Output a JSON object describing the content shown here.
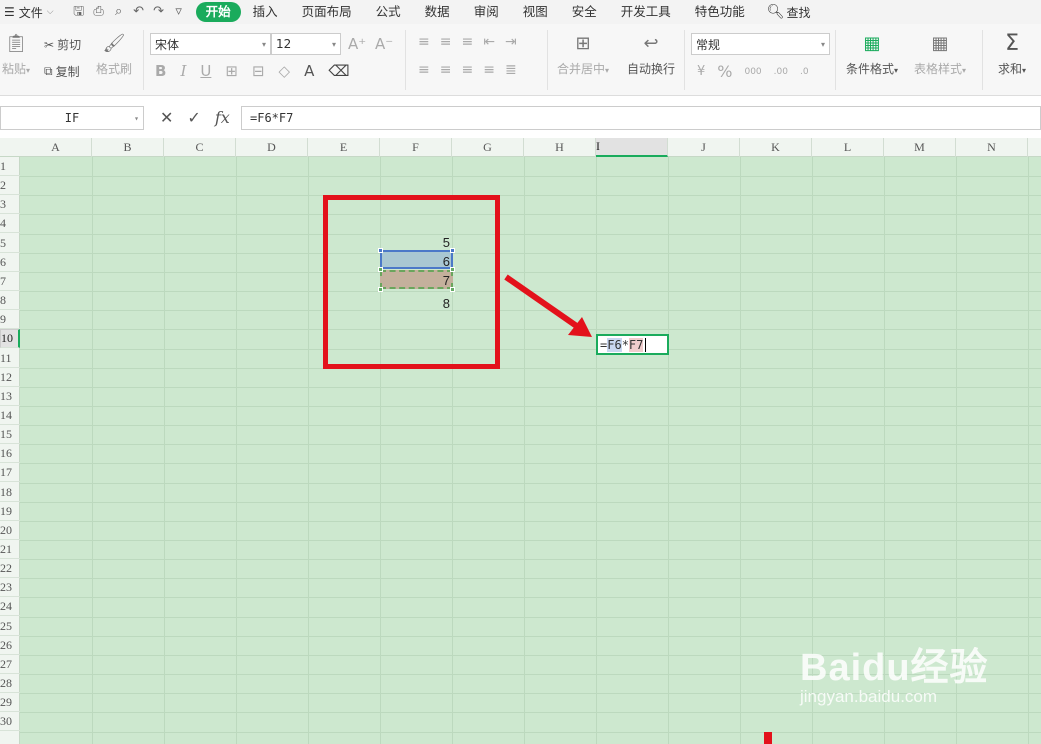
{
  "menu": {
    "file_label": "文件",
    "tabs": [
      "开始",
      "插入",
      "页面布局",
      "公式",
      "数据",
      "审阅",
      "视图",
      "安全",
      "开发工具",
      "特色功能"
    ],
    "active_tab": "开始",
    "search_label": "查找"
  },
  "ribbon": {
    "paste": "粘贴",
    "cut": "剪切",
    "copy": "复制",
    "format_painter": "格式刷",
    "font_name": "宋体",
    "font_size": "12",
    "merge_center": "合并居中",
    "wrap_text": "自动换行",
    "number_format": "常规",
    "conditional_format": "条件格式",
    "table_style": "表格样式",
    "sum": "求和"
  },
  "formula_bar": {
    "name_box": "IF",
    "formula": "=F6*F7"
  },
  "sheet": {
    "columns": [
      "A",
      "B",
      "C",
      "D",
      "E",
      "F",
      "G",
      "H",
      "I",
      "J",
      "K",
      "L",
      "M",
      "N"
    ],
    "selected_column": "I",
    "rows": [
      "1",
      "2",
      "3",
      "4",
      "5",
      "6",
      "7",
      "8",
      "9",
      "10",
      "11",
      "12",
      "13",
      "14",
      "15",
      "16",
      "17",
      "18",
      "19",
      "20",
      "21",
      "22",
      "23",
      "24",
      "25",
      "26",
      "27",
      "28",
      "29",
      "30"
    ],
    "selected_row": "10",
    "cells": {
      "F5": "5",
      "F6": "6",
      "F7": "7",
      "F8": "8"
    },
    "edit_cell": {
      "eq": "=",
      "ref1": "F6",
      "op": "*",
      "ref2": "F7"
    },
    "grid_color": "#cde8cf"
  },
  "watermark": {
    "logo": "Baidu经验",
    "url": "jingyan.baidu.com"
  }
}
